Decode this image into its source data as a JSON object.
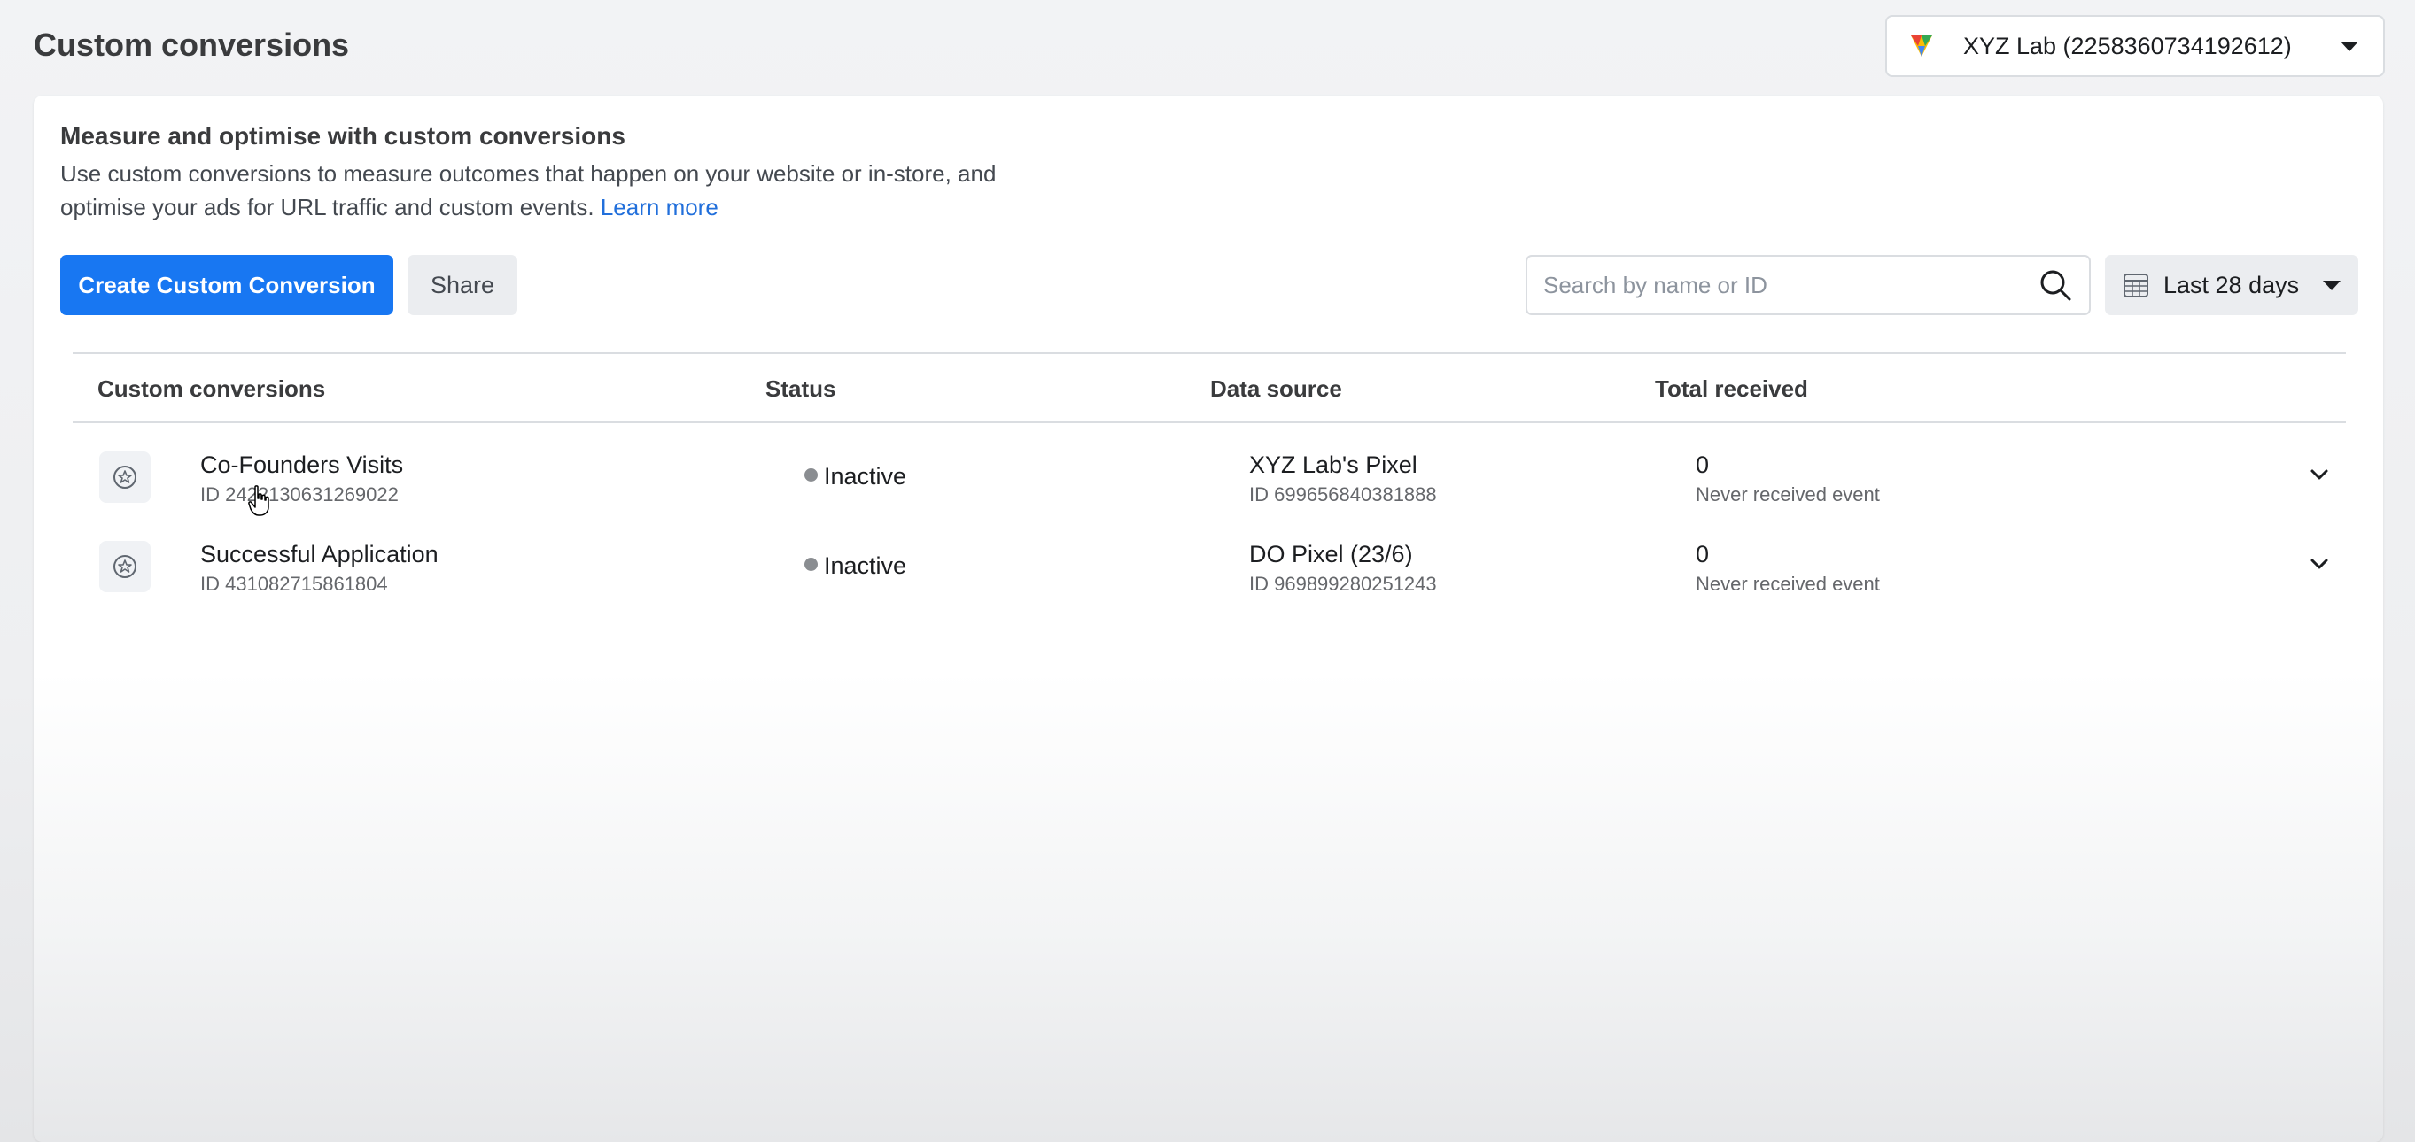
{
  "header": {
    "title": "Custom conversions",
    "account": "XYZ Lab (2258360734192612)"
  },
  "intro": {
    "title": "Measure and optimise with custom conversions",
    "text": "Use custom conversions to measure outcomes that happen on your website or in-store, and optimise your ads for URL traffic and custom events.",
    "learn_more": "Learn more"
  },
  "toolbar": {
    "create_label": "Create Custom Conversion",
    "share_label": "Share",
    "search_placeholder": "Search by name or ID",
    "date_range": "Last 28 days"
  },
  "table": {
    "columns": [
      "Custom conversions",
      "Status",
      "Data source",
      "Total received"
    ],
    "rows": [
      {
        "name": "Co-Founders Visits",
        "id": "ID 2422130631269022",
        "status": "Inactive",
        "source": "XYZ Lab's Pixel",
        "source_id": "ID 699656840381888",
        "total": "0",
        "total_note": "Never received event"
      },
      {
        "name": "Successful Application",
        "id": "ID 431082715861804",
        "status": "Inactive",
        "source": "DO Pixel (23/6)",
        "source_id": "ID 969899280251243",
        "total": "0",
        "total_note": "Never received event"
      }
    ]
  },
  "icons": {
    "account_logo": "triangle-logo-icon",
    "search": "search-icon",
    "calendar": "calendar-icon",
    "row_icon": "star-badge-icon",
    "expand": "chevron-down-icon"
  },
  "colors": {
    "primary": "#1877f2",
    "link": "#216fdb",
    "status_inactive": "#8a8d91"
  }
}
